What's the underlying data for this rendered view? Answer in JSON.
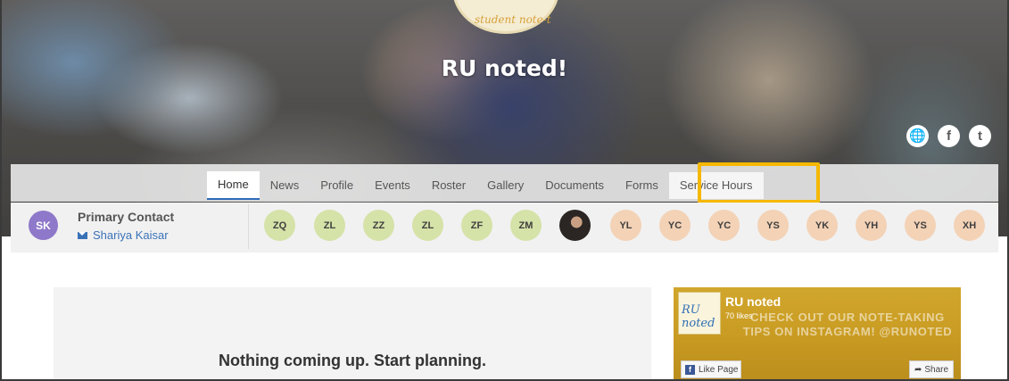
{
  "hero": {
    "logo_text": "student note-t",
    "title": "RU noted!",
    "social_icons": [
      "globe-icon",
      "facebook-icon",
      "twitter-icon"
    ]
  },
  "nav": {
    "tabs": [
      {
        "label": "Home",
        "active": true
      },
      {
        "label": "News"
      },
      {
        "label": "Profile"
      },
      {
        "label": "Events"
      },
      {
        "label": "Roster"
      },
      {
        "label": "Gallery"
      },
      {
        "label": "Documents"
      },
      {
        "label": "Forms"
      },
      {
        "label": "Service Hours",
        "highlighted": true
      }
    ],
    "highlight_color": "#f5b800",
    "active_underline_color": "#2e6bb8"
  },
  "members": {
    "primary_contact": {
      "initials": "SK",
      "title": "Primary Contact",
      "name": "Shariya Kaisar",
      "avatar_color": "#8e78c9"
    },
    "chips": [
      {
        "initials": "ZQ",
        "color": "#d5e2a8"
      },
      {
        "initials": "ZL",
        "color": "#d5e2a8"
      },
      {
        "initials": "ZZ",
        "color": "#d5e2a8"
      },
      {
        "initials": "ZL",
        "color": "#d5e2a8"
      },
      {
        "initials": "ZF",
        "color": "#d5e2a8"
      },
      {
        "initials": "ZM",
        "color": "#d5e2a8"
      },
      {
        "initials": "",
        "photo": true
      },
      {
        "initials": "YL",
        "color": "#f3d2b6"
      },
      {
        "initials": "YC",
        "color": "#f3d2b6"
      },
      {
        "initials": "YC",
        "color": "#f3d2b6"
      },
      {
        "initials": "YS",
        "color": "#f3d2b6"
      },
      {
        "initials": "YK",
        "color": "#f3d2b6"
      },
      {
        "initials": "YH",
        "color": "#f3d2b6"
      },
      {
        "initials": "YS",
        "color": "#f3d2b6"
      },
      {
        "initials": "XH",
        "color": "#f3d2b6"
      }
    ]
  },
  "events": {
    "empty_message": "Nothing coming up. Start planning."
  },
  "facebook": {
    "logo_text": "RU noted",
    "page_name": "RU noted",
    "likes": "70 likes",
    "promo_text": "CHECK OUT OUR NOTE-TAKING TIPS ON INSTAGRAM! @RUNOTED",
    "like_button": "Like Page",
    "share_button": "Share"
  }
}
